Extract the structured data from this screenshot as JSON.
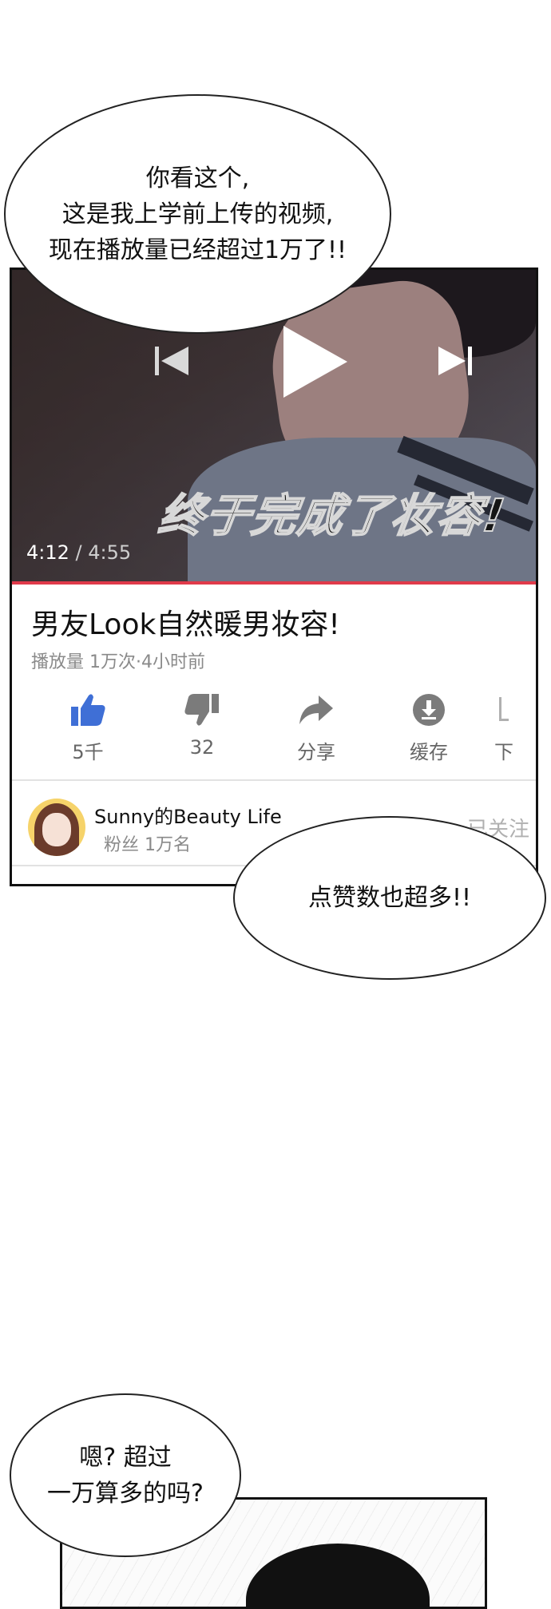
{
  "bubbles": {
    "intro": "你看这个,\n这是我上学前上传的视频,\n现在播放量已经超过1万了!!",
    "likes_many": "点赞数也超多!!",
    "question": "嗯? 超过\n一万算多的吗?"
  },
  "video": {
    "caption": "终于完成了妆容!",
    "time_current": "4:12",
    "time_separator": " / ",
    "time_total": "4:55",
    "controls": [
      "previous-icon",
      "play-icon",
      "next-icon"
    ]
  },
  "info": {
    "title": "男友Look自然暖男妆容!",
    "meta": "播放量 1万次·4小时前"
  },
  "actions": [
    {
      "icon": "thumbs-up-icon",
      "label": "5千",
      "color": "#3f6fd6"
    },
    {
      "icon": "thumbs-down-icon",
      "label": "32",
      "color": "#7b7b7b"
    },
    {
      "icon": "share-icon",
      "label": "分享",
      "color": "#7b7b7b"
    },
    {
      "icon": "download-icon",
      "label": "缓存",
      "color": "#7b7b7b"
    },
    {
      "icon": "more-icon",
      "label": "下",
      "color": "#7b7b7b"
    }
  ],
  "channel": {
    "name": "Sunny的Beauty Life",
    "fans": "粉丝 1万名",
    "follow_label": "已关注"
  }
}
